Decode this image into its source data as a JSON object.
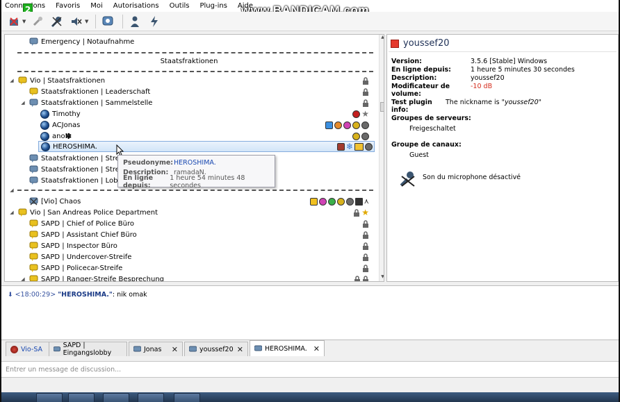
{
  "menu": [
    "Connexions",
    "Favoris",
    "Moi",
    "Autorisations",
    "Outils",
    "Plug-ins",
    "Aide"
  ],
  "watermark": "www.BANDICAM.com",
  "overlay_badge": "2",
  "toolbar": {
    "buttons": [
      "disconnect-icon",
      "connection-settings-icon",
      "mute-microphone-icon",
      "mute-speakers-icon",
      "away-icon",
      "contacts-icon",
      "hotkey-icon"
    ]
  },
  "tree": {
    "top_channel": "Emergency | Notaufnahme",
    "spacer1": "Staatsfraktionen",
    "vio_staat": "Vio | Staatsfraktionen",
    "leaderschaft": "Staatsfraktionen | Leaderschaft",
    "sammelstelle": "Staatsfraktionen | Sammelstelle",
    "users": [
      "Timothy",
      "ACJonas",
      "anoN",
      "HEROSHIMA."
    ],
    "streife1": "Staatsfraktionen | Streife I",
    "streife2": "Staatsfraktionen | Streife II",
    "lobby": "Staatsfraktionen | Lobby",
    "chaos": "[Vio] Chaos",
    "sapd_root": "Vio | San Andreas Police Department",
    "sapd": [
      "SAPD | Chief of Police Büro",
      "SAPD | Assistant Chief Büro",
      "SAPD | Inspector Büro",
      "SAPD | Undercover-Streife",
      "SAPD | Policecar-Streife",
      "SAPD | Ranger-Streife Besprechung"
    ]
  },
  "tooltip": {
    "nick_label": "Pseudonyme:",
    "nick": "HEROSHIMA.",
    "desc_label": "Description:",
    "desc": "ramadaN.",
    "online_label": "En ligne depuis:",
    "online": "1 heure 54 minutes 48 secondes"
  },
  "info": {
    "name": "youssef20",
    "version_label": "Version:",
    "version": "3.5.6 [Stable] Windows",
    "online_label": "En ligne depuis:",
    "online": "1 heure 5 minutes 30 secondes",
    "desc_label": "Description:",
    "desc": "youssef20",
    "volume_label": "Modificateur de volume:",
    "volume": "-10 dB",
    "plugin_label": "Test plugin info:",
    "plugin_text": "The nickname is ",
    "plugin_nick": "\"youssef20\"",
    "server_groups_label": "Groupes de serveurs:",
    "server_group": "Freigeschaltet",
    "channel_group_label": "Groupe de canaux:",
    "channel_group": "Guest",
    "mic_status": "Son du microphone désactivé"
  },
  "chat": {
    "time": "<18:00:29>",
    "nick": "\"HEROSHIMA.\"",
    "msg": ": nik omak"
  },
  "tabs": [
    {
      "label": "Vio-SA",
      "active": false
    },
    {
      "label": "SAPD | Eingangslobby",
      "active": false
    },
    {
      "label": "Jonas",
      "active": false
    },
    {
      "label": "youssef20",
      "active": false
    },
    {
      "label": "HEROSHIMA.",
      "active": true
    }
  ],
  "input": {
    "placeholder": "Entrer un message de discussion..."
  },
  "colors": {
    "accent": "#1747b0",
    "warn": "#d52c1c",
    "selection": "#d2e5f8"
  }
}
